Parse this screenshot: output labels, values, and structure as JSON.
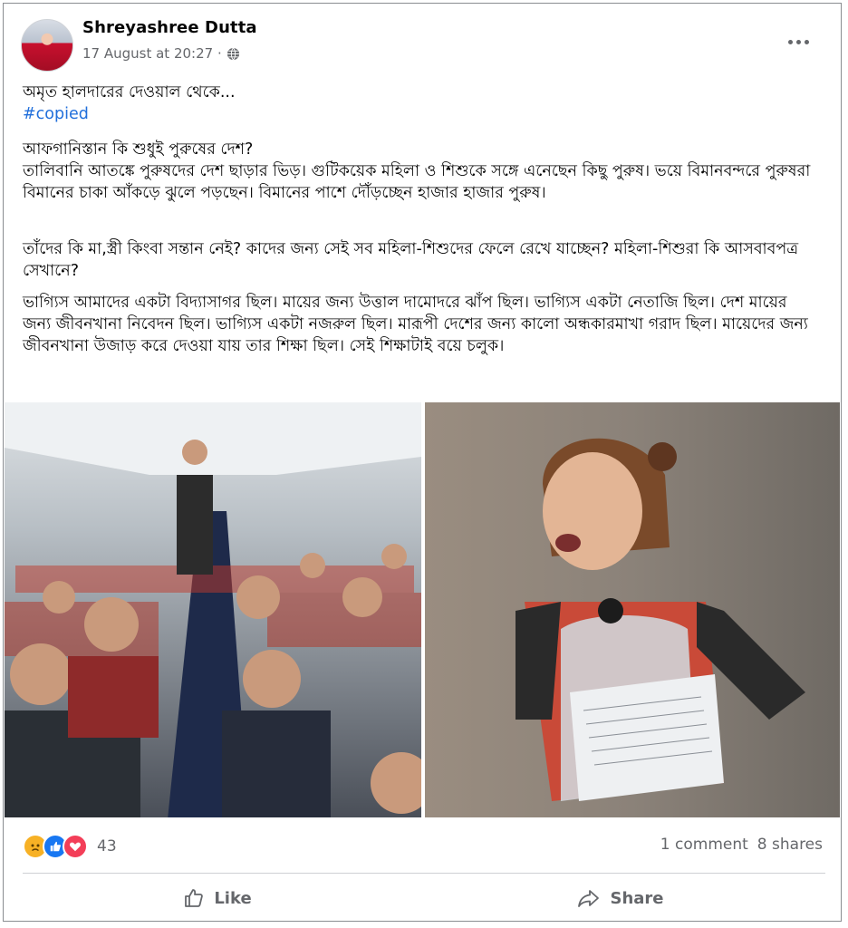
{
  "post": {
    "author": "Shreyashree Dutta",
    "timestamp": "17 August at 20:27 ·",
    "privacy_icon": "globe-icon",
    "more_icon": "more-options-icon",
    "intro": "অমৃত হালদারের দেওয়াল থেকে...",
    "hashtag": "#copied",
    "paragraph_1": "আফগানিস্তান কি শুধুই পুরুষের দেশ?\nতালিবানি আতঙ্কে পুরুষদের দেশ ছাড়ার ভিড়। গুটিকয়েক মহিলা ও শিশুকে সঙ্গে এনেছেন কিছু পুরুষ। ভয়ে বিমানবন্দরে পুরুষরা বিমানের চাকা আঁকড়ে ঝুলে পড়ছেন। বিমানের পাশে দৌঁড়চ্ছেন হাজার হাজার পুরুষ।",
    "paragraph_2": "তাঁদের কি মা,স্ত্রী কিংবা সন্তান নেই? কাদের জন্য সেই সব মহিলা-শিশুদের ফেলে রেখে যাচ্ছেন? মহিলা-শিশুরা কি আসবাবপত্র সেখানে?",
    "paragraph_3": "ভাগ্যিস আমাদের একটা বিদ্যাসাগর ছিল। মায়ের জন্য উত্তাল দামোদরে ঝাঁপ ছিল। ভাগ্যিস একটা নেতাজি ছিল। দেশ মায়ের জন্য জীবনখানা নিবেদন ছিল। ভাগ্যিস একটা নজরুল ছিল। মারূপী দেশের জন্য কালো অন্ধকারমাখা গরাদ ছিল। মায়েদের জন্য জীবনখানা উজাড় করে দেওয়া যায় তার শিক্ষা ছিল। সেই শিক্ষাটাই বয়ে চলুক।"
  },
  "photos": [
    {
      "name": "airplane-cabin-photo"
    },
    {
      "name": "crying-girl-photo"
    }
  ],
  "footer": {
    "reaction_icons": [
      "sad-reaction-icon",
      "like-reaction-icon",
      "love-reaction-icon"
    ],
    "reaction_count": "43",
    "comments": "1 comment",
    "shares": "8 shares",
    "like_label": "Like",
    "share_label": "Share"
  },
  "colors": {
    "text": "#050505",
    "muted": "#65676b",
    "link": "#216fdb",
    "like_blue": "#1877f2",
    "love_red": "#f33e58",
    "sad_yellow": "#f7b125"
  }
}
